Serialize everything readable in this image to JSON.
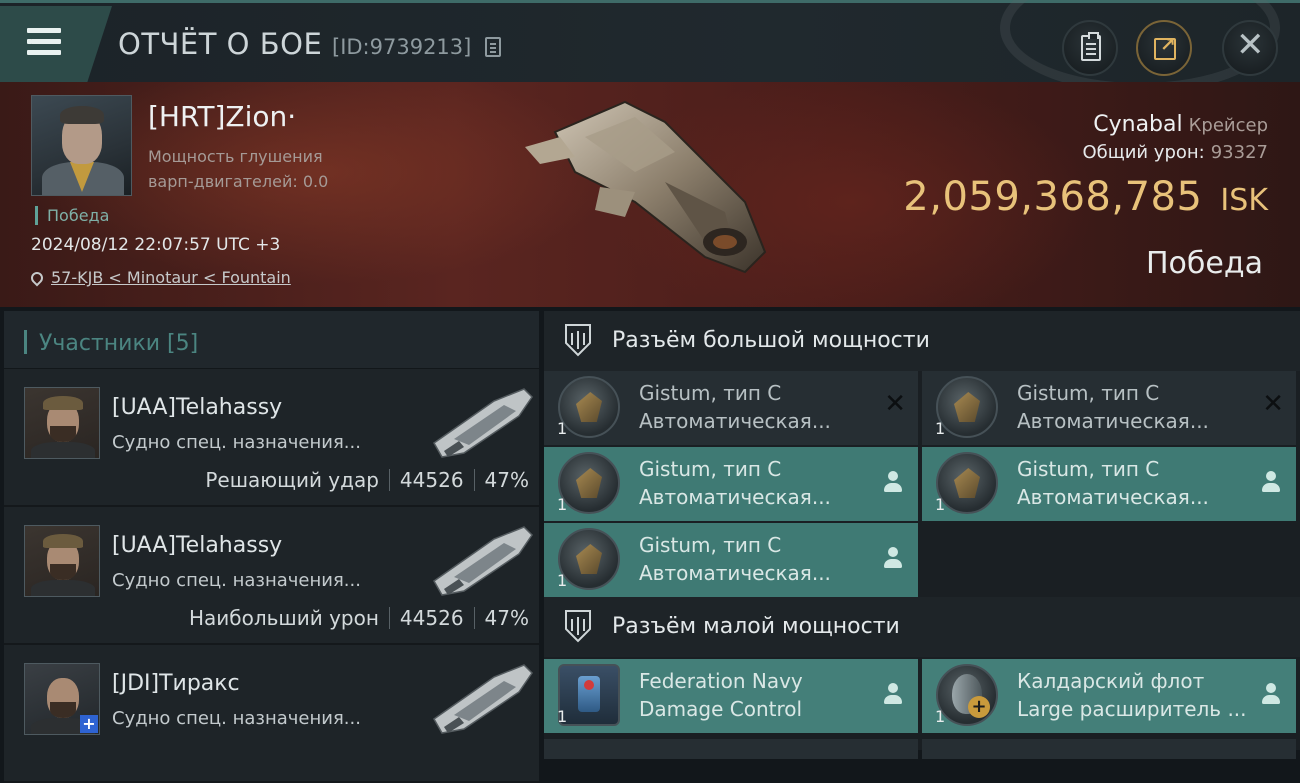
{
  "titlebar": {
    "title": "ОТЧЁТ О БОЕ",
    "report_id": "[ID:9739213]",
    "icons": [
      "menu-icon",
      "copy-icon",
      "clipboard-icon",
      "share-icon",
      "close-icon"
    ]
  },
  "victim": {
    "name": "[HRT]Zion·",
    "warp_label": "Мощность глушения",
    "warp_value": "варп-двигателей: 0.0",
    "tag": "Победа",
    "datetime": "2024/08/12 22:07:57 UTC +3",
    "location": "57-KJB < Minotaur < Fountain",
    "ship_name": "Cynabal",
    "ship_class": "Крейсер",
    "damage_label": "Общий урон:",
    "damage_value": "93327",
    "isk_amount": "2,059,368,785",
    "isk_unit": "ISK",
    "result": "Победа"
  },
  "participants": {
    "header": "Участники [5]",
    "rows": [
      {
        "name": "[UAA]Telahassy",
        "ship": "Судно спец. назначения...",
        "role": "Решающий удар",
        "damage": "44526",
        "percent": "47%"
      },
      {
        "name": "[UAA]Telahassy",
        "ship": "Судно спец. назначения...",
        "role": "Наибольший урон",
        "damage": "44526",
        "percent": "47%"
      },
      {
        "name": "[JDI]Тиракс",
        "ship": "Судно спец. назначения...",
        "role": "",
        "damage": "",
        "percent": ""
      }
    ]
  },
  "slots": {
    "high_label": "Разъём большой мощности",
    "low_label": "Разъём малой мощности",
    "high": [
      {
        "qty": "1",
        "line1": "Gistum, тип C",
        "line2": "Автоматическая...",
        "state": "destroyed"
      },
      {
        "qty": "1",
        "line1": "Gistum, тип C",
        "line2": "Автоматическая...",
        "state": "destroyed"
      },
      {
        "qty": "1",
        "line1": "Gistum, тип C",
        "line2": "Автоматическая...",
        "state": "dropped"
      },
      {
        "qty": "1",
        "line1": "Gistum, тип C",
        "line2": "Автоматическая...",
        "state": "dropped"
      },
      {
        "qty": "1",
        "line1": "Gistum, тип C",
        "line2": "Автоматическая...",
        "state": "dropped"
      }
    ],
    "low": [
      {
        "qty": "1",
        "line1": "Federation Navy",
        "line2": "Damage Control",
        "state": "dropped"
      },
      {
        "qty": "1",
        "line1": "Калдарский флот",
        "line2": "Large расширитель ...",
        "state": "dropped"
      }
    ]
  },
  "colors": {
    "accent_teal": "#3f7a74",
    "isk_gold": "#e8c27a",
    "header_red": "#5a2520"
  }
}
